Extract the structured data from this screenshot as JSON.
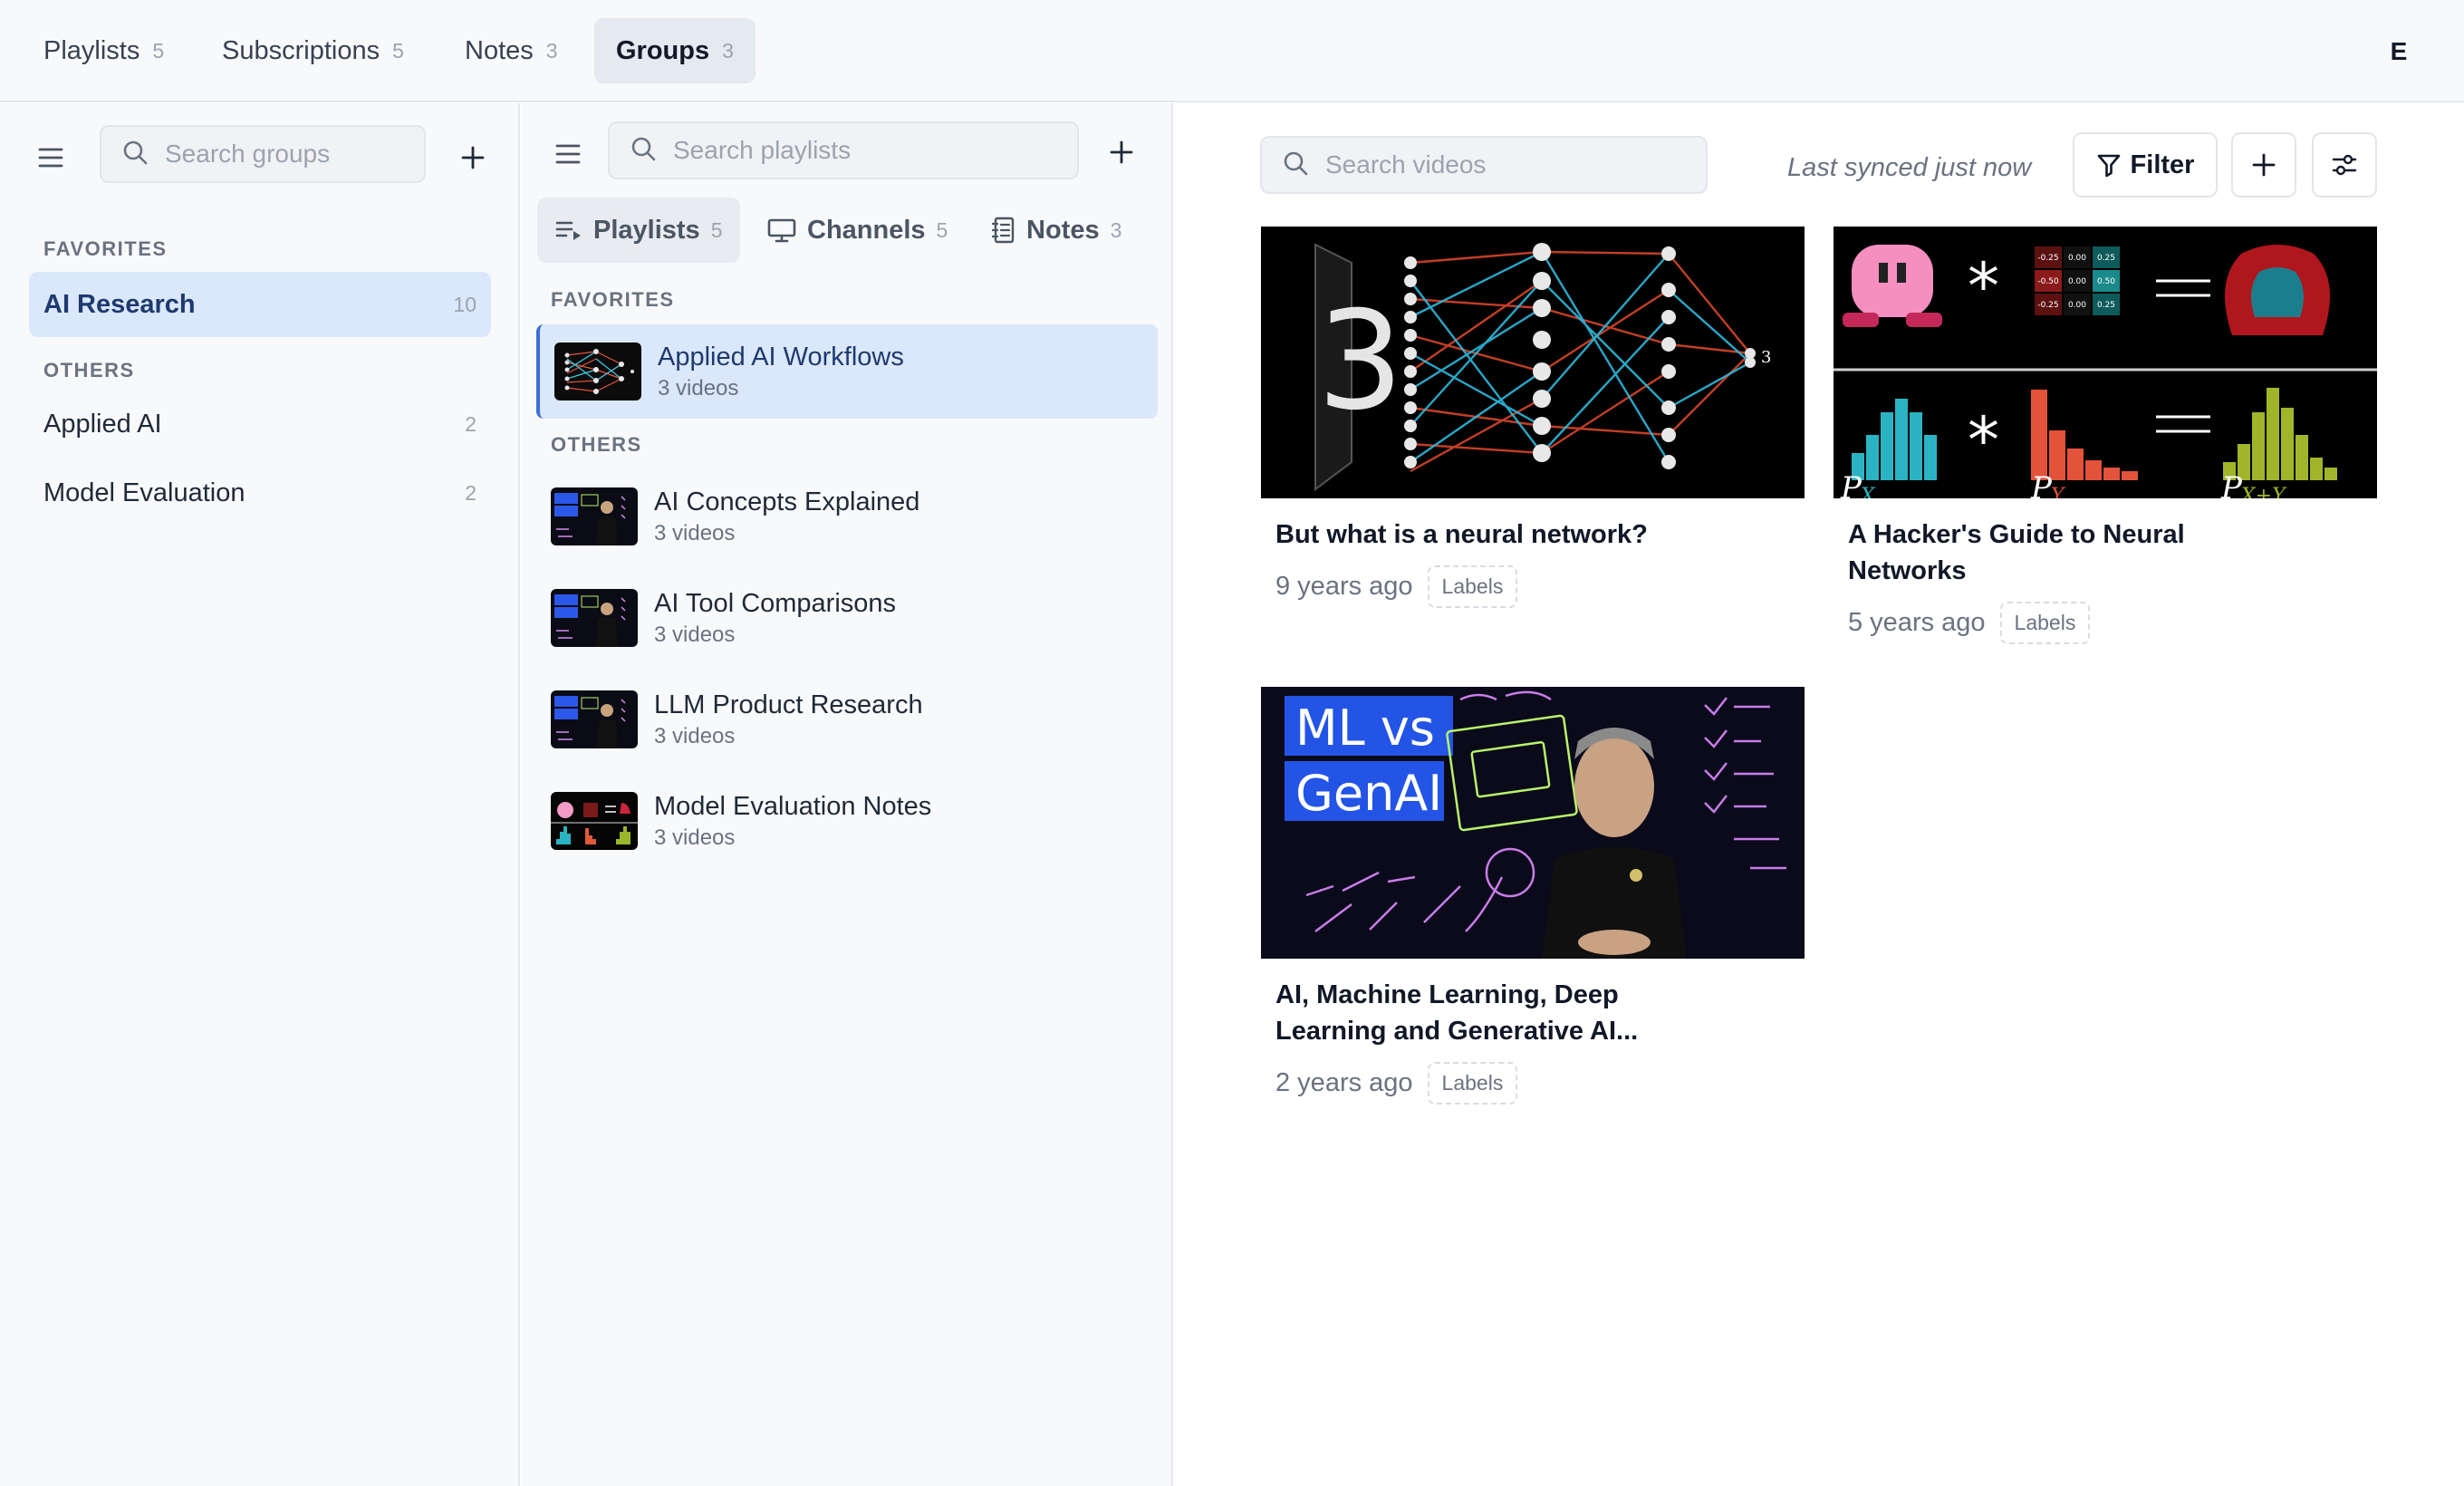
{
  "topbar": {
    "tabs": [
      {
        "label": "Playlists",
        "count": "5"
      },
      {
        "label": "Subscriptions",
        "count": "5"
      },
      {
        "label": "Notes",
        "count": "3"
      },
      {
        "label": "Groups",
        "count": "3"
      }
    ],
    "active_tab": "Groups",
    "avatar_initial": "E"
  },
  "groups_pane": {
    "search_placeholder": "Search groups",
    "favorites_label": "FAVORITES",
    "others_label": "OTHERS",
    "favorites": [
      {
        "name": "AI Research",
        "count": "10"
      }
    ],
    "others": [
      {
        "name": "Applied AI",
        "count": "2"
      },
      {
        "name": "Model Evaluation",
        "count": "2"
      }
    ],
    "icons": [
      "menu-icon",
      "search-icon",
      "plus-icon"
    ]
  },
  "playlists_pane": {
    "search_placeholder": "Search playlists",
    "tabs": [
      {
        "label": "Playlists",
        "count": "5",
        "icon": "playlist-icon"
      },
      {
        "label": "Channels",
        "count": "5",
        "icon": "monitor-icon"
      },
      {
        "label": "Notes",
        "count": "3",
        "icon": "notebook-icon"
      }
    ],
    "favorites_label": "FAVORITES",
    "others_label": "OTHERS",
    "favorites": [
      {
        "name": "Applied AI Workflows",
        "sub": "3 videos"
      }
    ],
    "others": [
      {
        "name": "AI Concepts Explained",
        "sub": "3 videos"
      },
      {
        "name": "AI Tool Comparisons",
        "sub": "3 videos"
      },
      {
        "name": "LLM Product Research",
        "sub": "3 videos"
      },
      {
        "name": "Model Evaluation Notes",
        "sub": "3 videos"
      }
    ]
  },
  "videos_pane": {
    "search_placeholder": "Search videos",
    "synced_text": "Last synced just now",
    "filter_label": "Filter",
    "videos": [
      {
        "title": "But what is a neural network?",
        "ago": "9 years ago",
        "chip": "Labels"
      },
      {
        "title": "A Hacker's Guide to Neural Networks",
        "ago": "5 years ago",
        "chip": "Labels"
      },
      {
        "title": "AI, Machine Learning, Deep Learning and Generative AI...",
        "ago": "2 years ago",
        "chip": "Labels"
      }
    ],
    "thumb_text": {
      "ml_line1": "ML vs",
      "ml_line2": "GenAI",
      "digit": "3",
      "px": "P",
      "px_sub": "X",
      "py_sub": "Y",
      "pxy_sub": "X+Y",
      "m1": "-0.25",
      "m2": "0.00",
      "m3": "0.25",
      "m4": "-0.50",
      "m5": "0.50"
    }
  },
  "colors": {
    "accent": "#3b6fd8",
    "selected_bg": "#dbe7fb",
    "pane_bg": "#f8f9fb"
  }
}
